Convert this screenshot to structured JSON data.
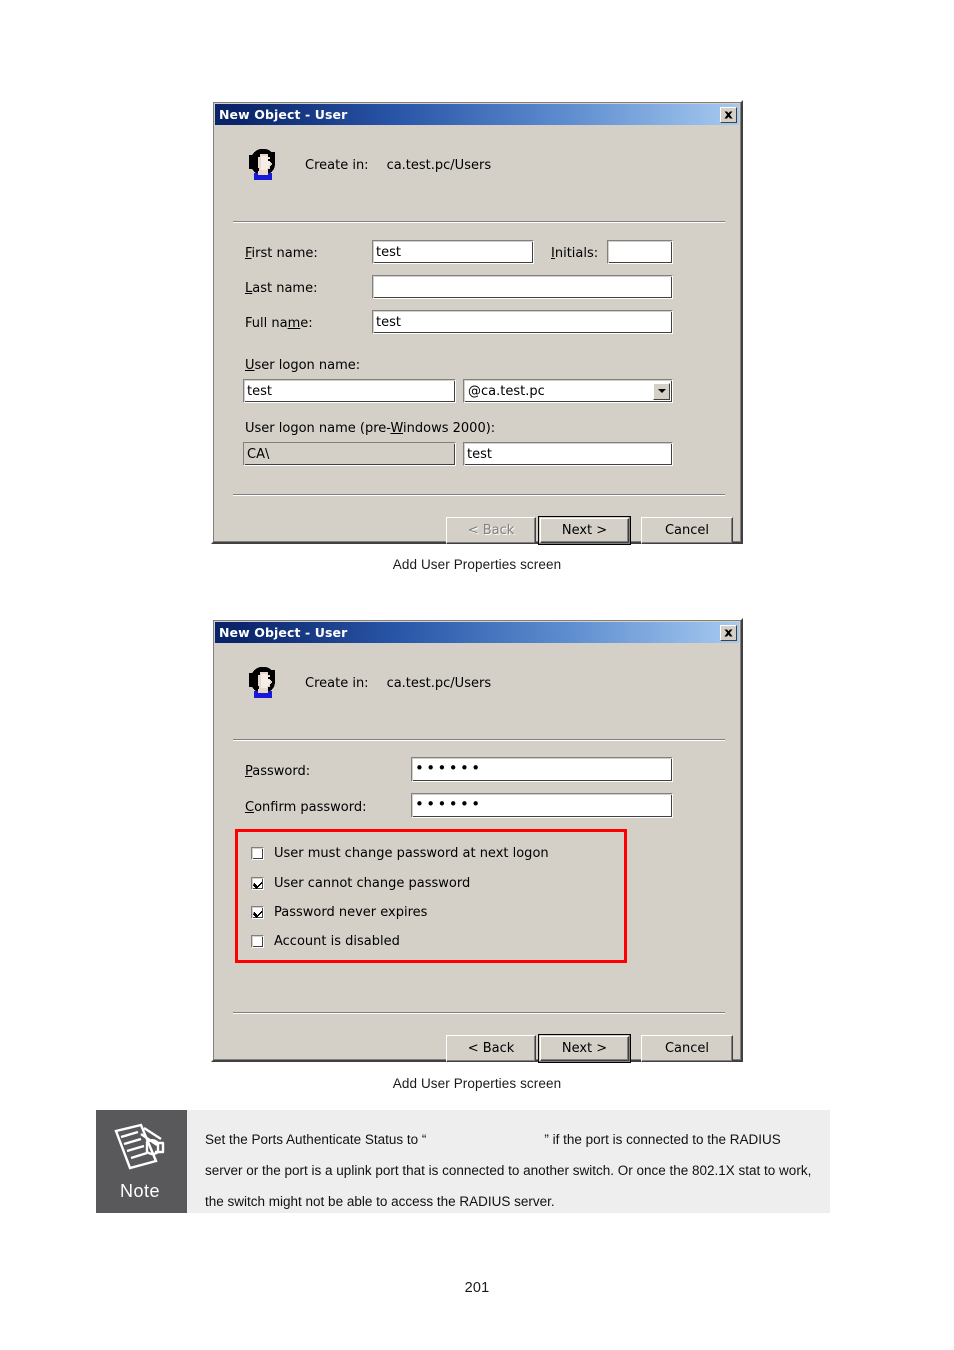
{
  "document": {
    "page_number": "201"
  },
  "figure1": {
    "caption": "Add User Properties screen",
    "dialog": {
      "title": "New Object - User",
      "close_icon": "close-icon",
      "user_icon": "user-head-icon",
      "create_in_label": "Create in:",
      "create_in_value": "ca.test.pc/Users",
      "fields": {
        "first_name_label": "First name:",
        "first_name_value": "test",
        "initials_label": "Initials:",
        "initials_value": "",
        "last_name_label": "Last name:",
        "last_name_value": "",
        "full_name_label": "Full name:",
        "full_name_value": "test",
        "user_logon_name_label": "User logon name:",
        "user_logon_name_value": "test",
        "domain_suffix_value": "@ca.test.pc",
        "domain_suffix_options": [
          "@ca.test.pc"
        ],
        "pre2000_label": "User logon name (pre-Windows 2000):",
        "pre2000_domain_value": "CA\\",
        "pre2000_name_value": "test"
      },
      "buttons": {
        "back": "< Back",
        "next": "Next >",
        "cancel": "Cancel"
      }
    }
  },
  "figure2": {
    "caption": "Add User Properties screen",
    "dialog": {
      "title": "New Object - User",
      "close_icon": "close-icon",
      "user_icon": "user-head-icon",
      "create_in_label": "Create in:",
      "create_in_value": "ca.test.pc/Users",
      "fields": {
        "password_label": "Password:",
        "password_value": "••••••",
        "confirm_password_label": "Confirm password:",
        "confirm_password_value": "••••••"
      },
      "checkboxes": [
        {
          "label": "User must change password at next logon",
          "checked": false
        },
        {
          "label": "User cannot change password",
          "checked": true
        },
        {
          "label": "Password never expires",
          "checked": true
        },
        {
          "label": "Account is disabled",
          "checked": false
        }
      ],
      "highlight_color": "#ff0000",
      "buttons": {
        "back": "< Back",
        "next": "Next >",
        "cancel": "Cancel"
      }
    }
  },
  "note": {
    "badge_label": "Note",
    "icon": "note-pencil-paper-icon",
    "text_part1": "Set the Ports Authenticate Status to “",
    "text_part2": "” if the port is connected to the RADIUS server or the port is a uplink port that is connected to another switch. Or once the 802.1X stat to work, the switch might not be able to access the RADIUS server."
  }
}
